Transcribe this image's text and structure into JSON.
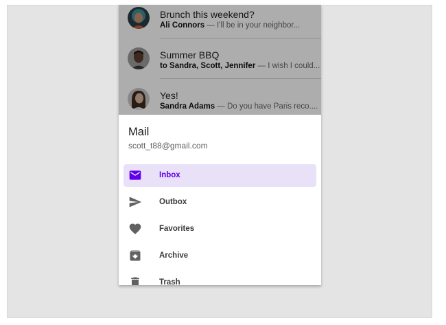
{
  "emails": [
    {
      "subject": "Brunch this weekend?",
      "sender": "Ali Connors",
      "preview": " — I'll be in your neighbor...",
      "avatar": "woman-teal-hair-avatar"
    },
    {
      "subject": "Summer BBQ",
      "sender": "to Sandra, Scott, Jennifer",
      "preview": " — I wish I could...",
      "avatar": "man-avatar"
    },
    {
      "subject": "Yes!",
      "sender": "Sandra Adams",
      "preview": " — Do you have Paris reco....",
      "avatar": "woman-avatar"
    }
  ],
  "drawer": {
    "title": "Mail",
    "subtitle": "scott_t88@gmail.com",
    "items": [
      {
        "label": "Inbox",
        "icon": "inbox-icon",
        "active": true
      },
      {
        "label": "Outbox",
        "icon": "send-icon",
        "active": false
      },
      {
        "label": "Favorites",
        "icon": "heart-icon",
        "active": false
      },
      {
        "label": "Archive",
        "icon": "archive-icon",
        "active": false
      },
      {
        "label": "Trash",
        "icon": "trash-icon",
        "active": false
      }
    ]
  },
  "colors": {
    "accent": "#6200ee",
    "active_bg": "#e9e1f8",
    "stage_bg": "#e4e4e4",
    "icon_gray": "#616161"
  }
}
